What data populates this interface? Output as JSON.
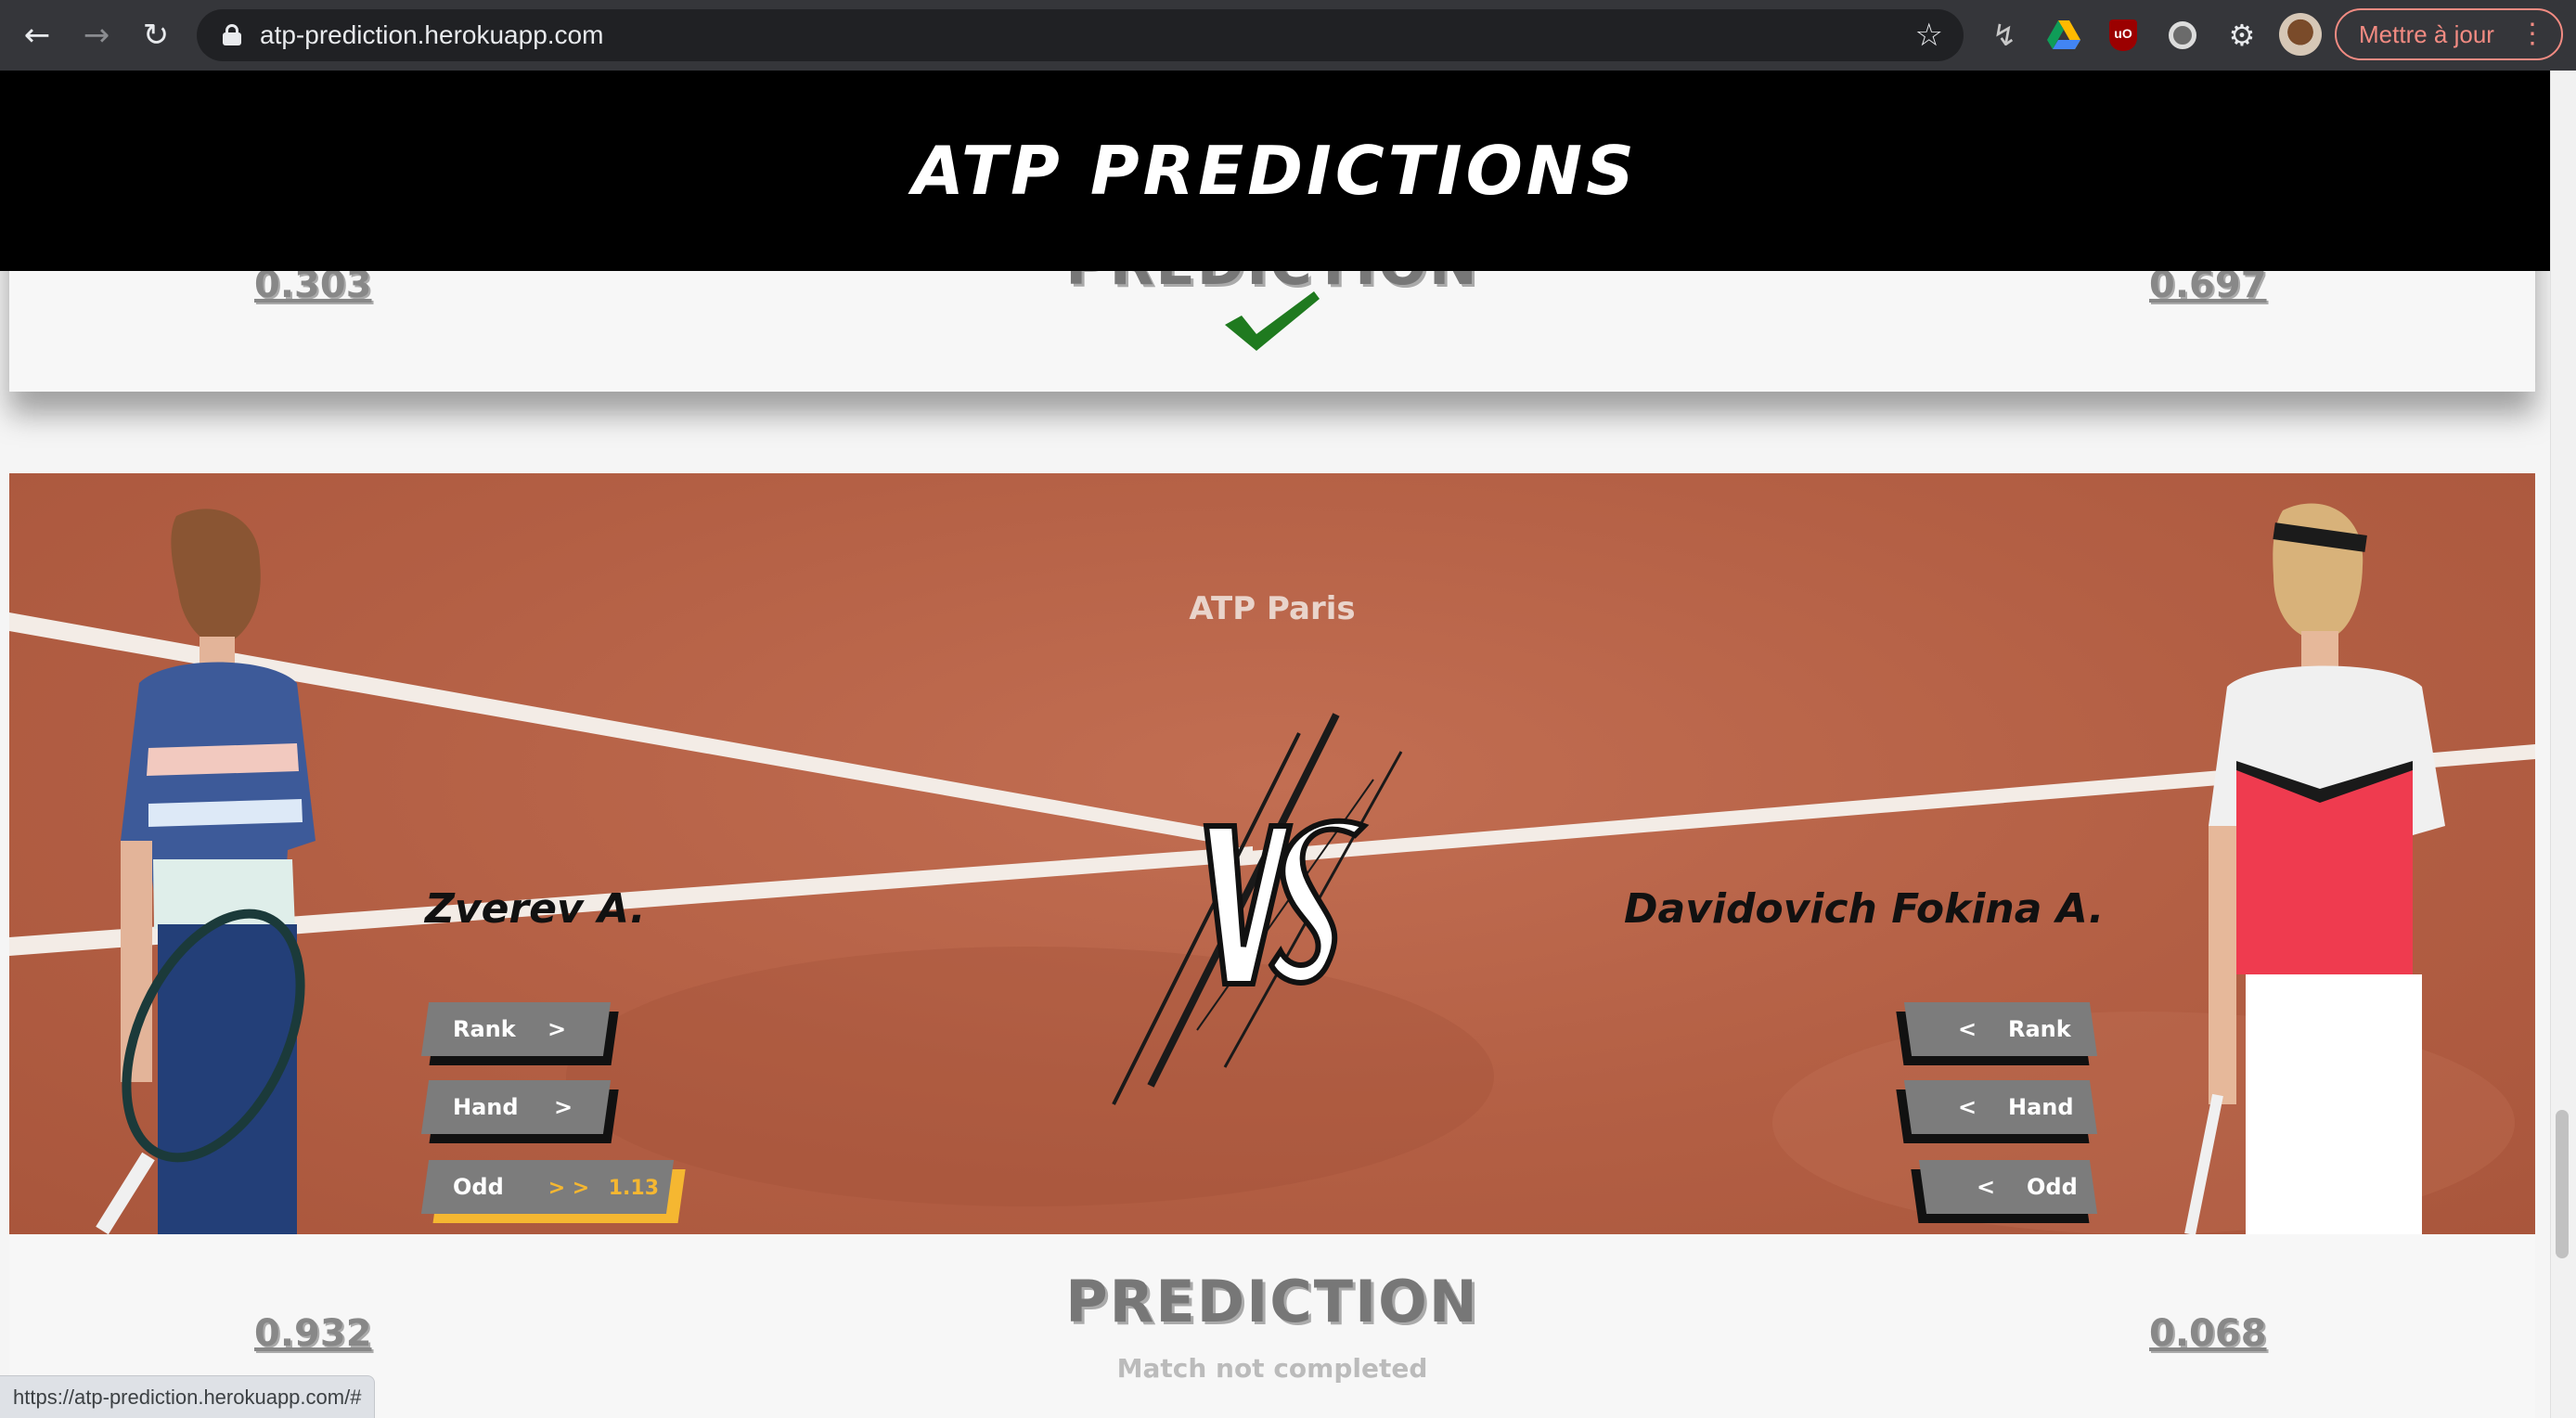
{
  "browser": {
    "url": "atp-prediction.herokuapp.com",
    "update_label": "Mettre à jour",
    "status_url": "https://atp-prediction.herokuapp.com/#",
    "icons": [
      "back-arrow-icon",
      "forward-arrow-icon",
      "reload-icon",
      "lock-icon",
      "star-icon",
      "pulse-extension-icon",
      "google-drive-icon",
      "ublock-icon",
      "circle-extension-icon",
      "puzzle-extensions-icon",
      "profile-avatar",
      "more-vert-icon"
    ]
  },
  "site": {
    "title": "ATP PREDICTIONS"
  },
  "previous_match": {
    "heading": "PREDICTION",
    "prob_left": "0.303",
    "prob_right": "0.697",
    "result_icon": "checkmark-icon"
  },
  "match": {
    "tournament": "ATP Paris",
    "player_left": {
      "name": "Zverev A.",
      "rank_label": "Rank",
      "rank_arrow": ">",
      "hand_label": "Hand",
      "hand_arrow": ">",
      "odd_label": "Odd",
      "odd_arrow": "> >",
      "odd_value": "1.13"
    },
    "player_right": {
      "name": "Davidovich Fokina A.",
      "rank_label": "Rank",
      "rank_arrow": "<",
      "hand_label": "Hand",
      "hand_arrow": "<",
      "odd_label": "Odd",
      "odd_arrow": "<"
    },
    "prediction": {
      "heading": "PREDICTION",
      "prob_left": "0.932",
      "prob_right": "0.068",
      "status": "Match not completed"
    }
  },
  "colors": {
    "header_bg": "#000000",
    "clay": "#b35f44",
    "odd_accent": "#f5b731",
    "check_green": "#1f7a1f"
  }
}
